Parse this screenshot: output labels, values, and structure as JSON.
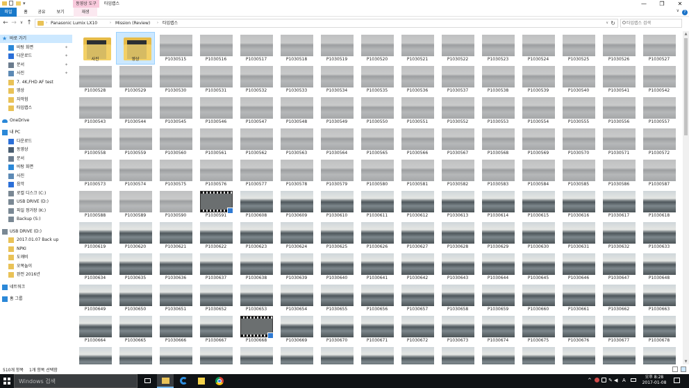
{
  "titlebar": {
    "quick_access_arrow": "▾",
    "context_tab": "동영상 도구",
    "window_title": "타임랩스",
    "min": "—",
    "max": "❐",
    "close": "✕"
  },
  "ribbon": {
    "tabs": [
      "파일",
      "홈",
      "공유",
      "보기"
    ],
    "context_tab_label": "재생",
    "help": "?",
    "collapse": "∨"
  },
  "address": {
    "back": "←",
    "forward": "→",
    "recent": "∨",
    "up": "↑",
    "crumbs": [
      "Panasonic Lumix LX10",
      "Mission (Review)",
      "타임랩스"
    ],
    "sep": "›",
    "dropdown": "∨",
    "refresh": "↻",
    "search_placeholder": "타임랩스 검색"
  },
  "nav": {
    "items": [
      {
        "label": "바로 가기",
        "indent": 0,
        "icon": "star-icon",
        "color": "#2b88d8",
        "selected": true
      },
      {
        "label": "바탕 화면",
        "indent": 1,
        "icon": "desktop-icon",
        "color": "#2b88d8",
        "pin": true
      },
      {
        "label": "다운로드",
        "indent": 1,
        "icon": "download-icon",
        "color": "#2b6fd8",
        "pin": true
      },
      {
        "label": "문서",
        "indent": 1,
        "icon": "documents-icon",
        "color": "#6b7c8e",
        "pin": true
      },
      {
        "label": "사진",
        "indent": 1,
        "icon": "pictures-icon",
        "color": "#5d8ab5",
        "pin": true
      },
      {
        "label": "7. 4K,FHD AF test",
        "indent": 1,
        "icon": "folder-icon",
        "color": "#e9c257"
      },
      {
        "label": "영상",
        "indent": 1,
        "icon": "folder-icon",
        "color": "#e9c257"
      },
      {
        "label": "자막험",
        "indent": 1,
        "icon": "folder-icon",
        "color": "#e9c257"
      },
      {
        "label": "타임랩스",
        "indent": 1,
        "icon": "folder-icon",
        "color": "#e9c257"
      },
      {
        "label": "OneDrive",
        "indent": 0,
        "icon": "onedrive-icon",
        "color": "#2b88d8",
        "gap": true
      },
      {
        "label": "내 PC",
        "indent": 0,
        "icon": "pc-icon",
        "color": "#2b88d8",
        "gap": true
      },
      {
        "label": "다운로드",
        "indent": 1,
        "icon": "download-icon",
        "color": "#2b6fd8"
      },
      {
        "label": "동영상",
        "indent": 1,
        "icon": "videos-icon",
        "color": "#4a5d70"
      },
      {
        "label": "문서",
        "indent": 1,
        "icon": "documents-icon",
        "color": "#6b7c8e"
      },
      {
        "label": "바탕 화면",
        "indent": 1,
        "icon": "desktop-icon",
        "color": "#2b88d8"
      },
      {
        "label": "사진",
        "indent": 1,
        "icon": "pictures-icon",
        "color": "#5d8ab5"
      },
      {
        "label": "음악",
        "indent": 1,
        "icon": "music-icon",
        "color": "#2b6fd8"
      },
      {
        "label": "로컬 디스크 (C:)",
        "indent": 1,
        "icon": "drive-icon",
        "color": "#7a8894"
      },
      {
        "label": "USB DRIVE (D:)",
        "indent": 1,
        "icon": "usb-drive-icon",
        "color": "#7a8894"
      },
      {
        "label": "파일 정거장 (K:)",
        "indent": 1,
        "icon": "drive-icon",
        "color": "#7a8894"
      },
      {
        "label": "Backup (S:)",
        "indent": 1,
        "icon": "drive-icon",
        "color": "#7a8894"
      },
      {
        "label": "USB DRIVE (D:)",
        "indent": 0,
        "icon": "usb-drive-icon",
        "color": "#7a8894",
        "gap": true
      },
      {
        "label": "2017.01.07 Back up",
        "indent": 1,
        "icon": "folder-icon",
        "color": "#e9c257"
      },
      {
        "label": "NPKI",
        "indent": 1,
        "icon": "folder-icon",
        "color": "#e9c257"
      },
      {
        "label": "도깨비",
        "indent": 1,
        "icon": "folder-icon",
        "color": "#e9c257"
      },
      {
        "label": "오복놀이",
        "indent": 1,
        "icon": "folder-icon",
        "color": "#e9c257"
      },
      {
        "label": "완전 2016년",
        "indent": 1,
        "icon": "folder-icon",
        "color": "#e9c257"
      },
      {
        "label": "네트워크",
        "indent": 0,
        "icon": "network-icon",
        "color": "#2b88d8",
        "gap": true
      },
      {
        "label": "홈 그룹",
        "indent": 0,
        "icon": "homegroup-icon",
        "color": "#2b88d8",
        "gap": true
      }
    ]
  },
  "files": {
    "folders": [
      "사진",
      "영상"
    ],
    "rows": [
      [
        "P1030515",
        "P1030516",
        "P1030517",
        "P1030518",
        "P1030519",
        "P1030520",
        "P1030521",
        "P1030522",
        "P1030523",
        "P1030524",
        "P1030525",
        "P1030526",
        "P1030527"
      ],
      [
        "P1030528",
        "P1030529",
        "P1030530",
        "P1030531",
        "P1030532",
        "P1030533",
        "P1030534",
        "P1030535",
        "P1030536",
        "P1030537",
        "P1030538",
        "P1030539",
        "P1030540",
        "P1030541",
        "P1030542"
      ],
      [
        "P1030543",
        "P1030544",
        "P1030545",
        "P1030546",
        "P1030547",
        "P1030548",
        "P1030549",
        "P1030550",
        "P1030551",
        "P1030552",
        "P1030553",
        "P1030554",
        "P1030555",
        "P1030556",
        "P1030557"
      ],
      [
        "P1030558",
        "P1030559",
        "P1030560",
        "P1030561",
        "P1030562",
        "P1030563",
        "P1030564",
        "P1030565",
        "P1030566",
        "P1030567",
        "P1030568",
        "P1030569",
        "P1030570",
        "P1030571",
        "P1030572"
      ],
      [
        "P1030573",
        "P1030574",
        "P1030575",
        "P1030576",
        "P1030577",
        "P1030578",
        "P1030579",
        "P1030580",
        "P1030581",
        "P1030582",
        "P1030583",
        "P1030584",
        "P1030585",
        "P1030586",
        "P1030587"
      ],
      [
        "P1030588",
        "P1030589",
        "P1030590",
        "P1030591",
        "P1030608",
        "P1030609",
        "P1030610",
        "P1030611",
        "P1030612",
        "P1030613",
        "P1030614",
        "P1030615",
        "P1030616",
        "P1030617",
        "P1030618"
      ],
      [
        "P1030619",
        "P1030620",
        "P1030621",
        "P1030622",
        "P1030623",
        "P1030624",
        "P1030625",
        "P1030626",
        "P1030627",
        "P1030628",
        "P1030629",
        "P1030630",
        "P1030631",
        "P1030632",
        "P1030633"
      ],
      [
        "P1030634",
        "P1030635",
        "P1030636",
        "P1030637",
        "P1030638",
        "P1030639",
        "P1030640",
        "P1030641",
        "P1030642",
        "P1030643",
        "P1030644",
        "P1030645",
        "P1030646",
        "P1030647",
        "P1030648"
      ],
      [
        "P1030649",
        "P1030650",
        "P1030651",
        "P1030652",
        "P1030653",
        "P1030654",
        "P1030655",
        "P1030656",
        "P1030657",
        "P1030658",
        "P1030659",
        "P1030660",
        "P1030661",
        "P1030662",
        "P1030663"
      ],
      [
        "P1030664",
        "P1030665",
        "P1030666",
        "P1030667",
        "P1030668",
        "P1030669",
        "P1030670",
        "P1030671",
        "P1030672",
        "P1030673",
        "P1030674",
        "P1030675",
        "P1030676",
        "P1030677",
        "P1030678"
      ],
      [
        "",
        "",
        "",
        "",
        "",
        "",
        "",
        "",
        "",
        "",
        "",
        "",
        "",
        "",
        ""
      ]
    ],
    "videos": [
      "P1030591",
      "P1030668"
    ],
    "port_start": "P1030608"
  },
  "status": {
    "count": "510개 항목",
    "selected": "1개 항목 선택함"
  },
  "taskbar": {
    "search_placeholder": "Windows 검색",
    "tray_up": "^",
    "ime": "A",
    "time": "오후 8:28",
    "date": "2017-01-08"
  }
}
